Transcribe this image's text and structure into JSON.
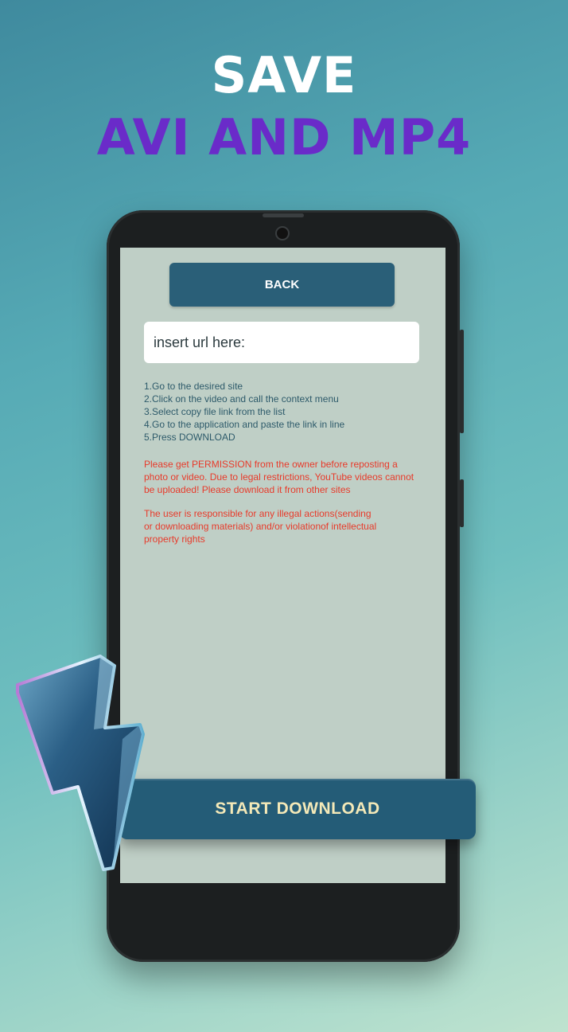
{
  "headline": {
    "line1": "SAVE",
    "line2": "AVI AND MP4"
  },
  "app": {
    "back_label": "BACK",
    "url_placeholder": "insert url here:",
    "instructions": [
      "1.Go to the desired site",
      "2.Click on the video and call the context menu",
      "3.Select copy file link from the list",
      "4.Go to the application and paste the link in line",
      "5.Press DOWNLOAD"
    ],
    "warning1": [
      "Please get PERMISSION from the owner before reposting a",
      "photo or video. Due to legal restrictions, YouTube videos cannot",
      "be uploaded! Please download it from other sites"
    ],
    "warning2": [
      "The user is responsible for any illegal actions(sending",
      "or downloading materials) and/or violationof intellectual",
      "property rights"
    ],
    "start_label": "START DOWNLOAD"
  },
  "colors": {
    "headline_white": "#ffffff",
    "headline_purple": "#6a2bc9",
    "button_bg": "#2a5f78",
    "start_text": "#f4e9b8",
    "warning_text": "#e83a2a",
    "screen_bg": "#bfcfc6"
  },
  "icons": {
    "decoration": "lightning-bolt-icon"
  }
}
